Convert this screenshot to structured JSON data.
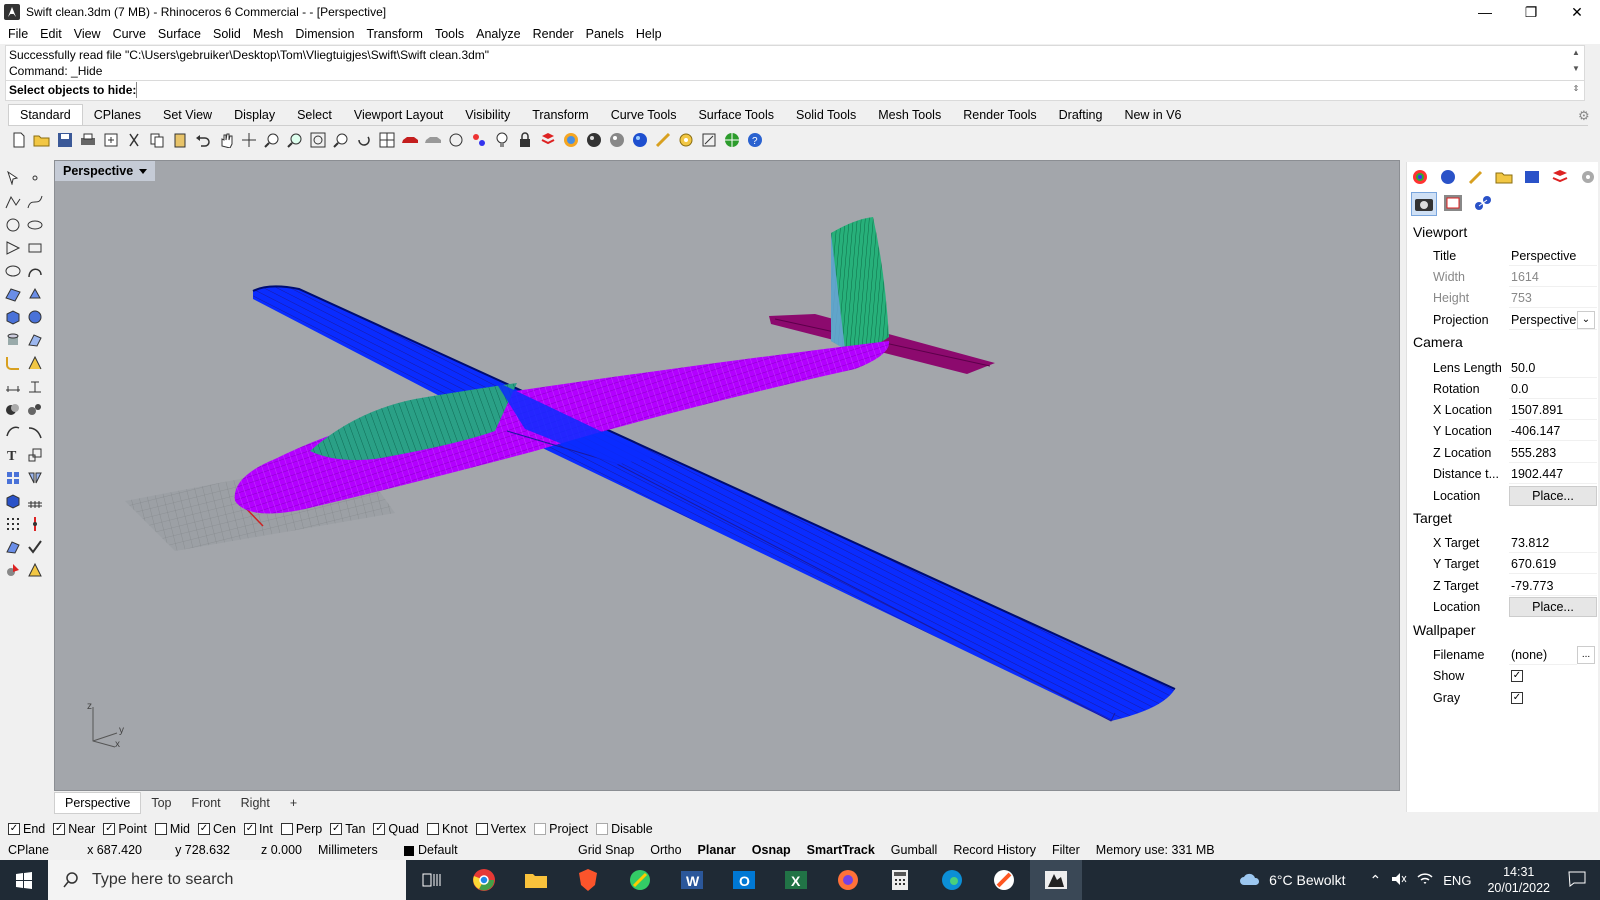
{
  "window": {
    "title": "Swift clean.3dm (7 MB) - Rhinoceros 6 Commercial - - [Perspective]"
  },
  "menu": [
    "File",
    "Edit",
    "View",
    "Curve",
    "Surface",
    "Solid",
    "Mesh",
    "Dimension",
    "Transform",
    "Tools",
    "Analyze",
    "Render",
    "Panels",
    "Help"
  ],
  "command": {
    "history1": "Successfully read file \"C:\\Users\\gebruiker\\Desktop\\Tom\\Vliegtuigjes\\Swift\\Swift clean.3dm\"",
    "history2": "Command: _Hide",
    "prompt": "Select objects to hide:",
    "input": ""
  },
  "tabs": [
    "Standard",
    "CPlanes",
    "Set View",
    "Display",
    "Select",
    "Viewport Layout",
    "Visibility",
    "Transform",
    "Curve Tools",
    "Surface Tools",
    "Solid Tools",
    "Mesh Tools",
    "Render Tools",
    "Drafting",
    "New in V6"
  ],
  "viewport": {
    "label": "Perspective",
    "axes": {
      "z": "z",
      "y": "y",
      "x": "x"
    }
  },
  "viewport_tabs": [
    "Perspective",
    "Top",
    "Front",
    "Right",
    "+"
  ],
  "osnaps": [
    {
      "label": "End",
      "checked": true
    },
    {
      "label": "Near",
      "checked": true
    },
    {
      "label": "Point",
      "checked": true
    },
    {
      "label": "Mid",
      "checked": false
    },
    {
      "label": "Cen",
      "checked": true
    },
    {
      "label": "Int",
      "checked": true
    },
    {
      "label": "Perp",
      "checked": false
    },
    {
      "label": "Tan",
      "checked": true
    },
    {
      "label": "Quad",
      "checked": true
    },
    {
      "label": "Knot",
      "checked": false
    },
    {
      "label": "Vertex",
      "checked": false
    },
    {
      "label": "Project",
      "checked": false
    },
    {
      "label": "Disable",
      "checked": false
    }
  ],
  "status": {
    "cplane": "CPlane",
    "x": "x 687.420",
    "y": "y 728.632",
    "z": "z 0.000",
    "units": "Millimeters",
    "layer": "Default",
    "grid_snap": "Grid Snap",
    "ortho": "Ortho",
    "planar": "Planar",
    "osnap": "Osnap",
    "smarttrack": "SmartTrack",
    "gumball": "Gumball",
    "record": "Record History",
    "filter": "Filter",
    "memory": "Memory use: 331 MB"
  },
  "panel": {
    "viewport_header": "Viewport",
    "title_label": "Title",
    "title_value": "Perspective",
    "width_label": "Width",
    "width_value": "1614",
    "height_label": "Height",
    "height_value": "753",
    "projection_label": "Projection",
    "projection_value": "Perspective",
    "camera_header": "Camera",
    "lens_label": "Lens Length",
    "lens_value": "50.0",
    "rotation_label": "Rotation",
    "rotation_value": "0.0",
    "xloc_label": "X Location",
    "xloc_value": "1507.891",
    "yloc_label": "Y Location",
    "yloc_value": "-406.147",
    "zloc_label": "Z Location",
    "zloc_value": "555.283",
    "dist_label": "Distance t...",
    "dist_value": "1902.447",
    "camloc_label": "Location",
    "camloc_button": "Place...",
    "target_header": "Target",
    "xt_label": "X Target",
    "xt_value": "73.812",
    "yt_label": "Y Target",
    "yt_value": "670.619",
    "zt_label": "Z Target",
    "zt_value": "-79.773",
    "tloc_label": "Location",
    "tloc_button": "Place...",
    "wallpaper_header": "Wallpaper",
    "filename_label": "Filename",
    "filename_value": "(none)",
    "filename_button": "...",
    "show_label": "Show",
    "show_checked": true,
    "gray_label": "Gray",
    "gray_checked": true
  },
  "taskbar": {
    "search_placeholder": "Type here to search",
    "weather": "6°C Bewolkt",
    "lang": "ENG",
    "time": "14:31",
    "date": "20/01/2022"
  },
  "colors": {
    "fuselage": "#b300ff",
    "wing": "#0a2cff",
    "canopy": "#1a9c78",
    "tail": "#1fa36b",
    "stab": "#8c0a6e",
    "viewport_bg": "#a3a6ab"
  }
}
